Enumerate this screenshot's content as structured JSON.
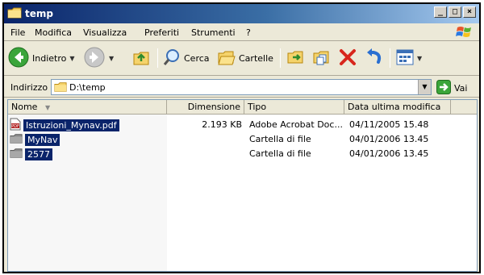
{
  "window": {
    "title": "temp"
  },
  "menu": [
    "File",
    "Modifica",
    "Visualizza",
    "Preferiti",
    "Strumenti",
    "?"
  ],
  "toolbar": {
    "back_label": "Indietro",
    "search_label": "Cerca",
    "folders_label": "Cartelle"
  },
  "address": {
    "label": "Indirizzo",
    "value": "D:\\temp",
    "go_label": "Vai"
  },
  "columns": {
    "name": "Nome",
    "size": "Dimensione",
    "type": "Tipo",
    "modified": "Data ultima modifica"
  },
  "files": [
    {
      "name": "Istruzioni_Mynav.pdf",
      "size": "2.193 KB",
      "type": "Adobe Acrobat Doc...",
      "modified": "04/11/2005 15.48",
      "icon": "pdf-file-icon"
    },
    {
      "name": "MyNav",
      "size": "",
      "type": "Cartella di file",
      "modified": "04/01/2006 13.45",
      "icon": "folder-icon"
    },
    {
      "name": "2577",
      "size": "",
      "type": "Cartella di file",
      "modified": "04/01/2006 13.45",
      "icon": "folder-icon"
    }
  ],
  "colors": {
    "title_gradient_start": "#0a246a",
    "selection": "#0a246a",
    "chrome": "#ece9d8"
  }
}
